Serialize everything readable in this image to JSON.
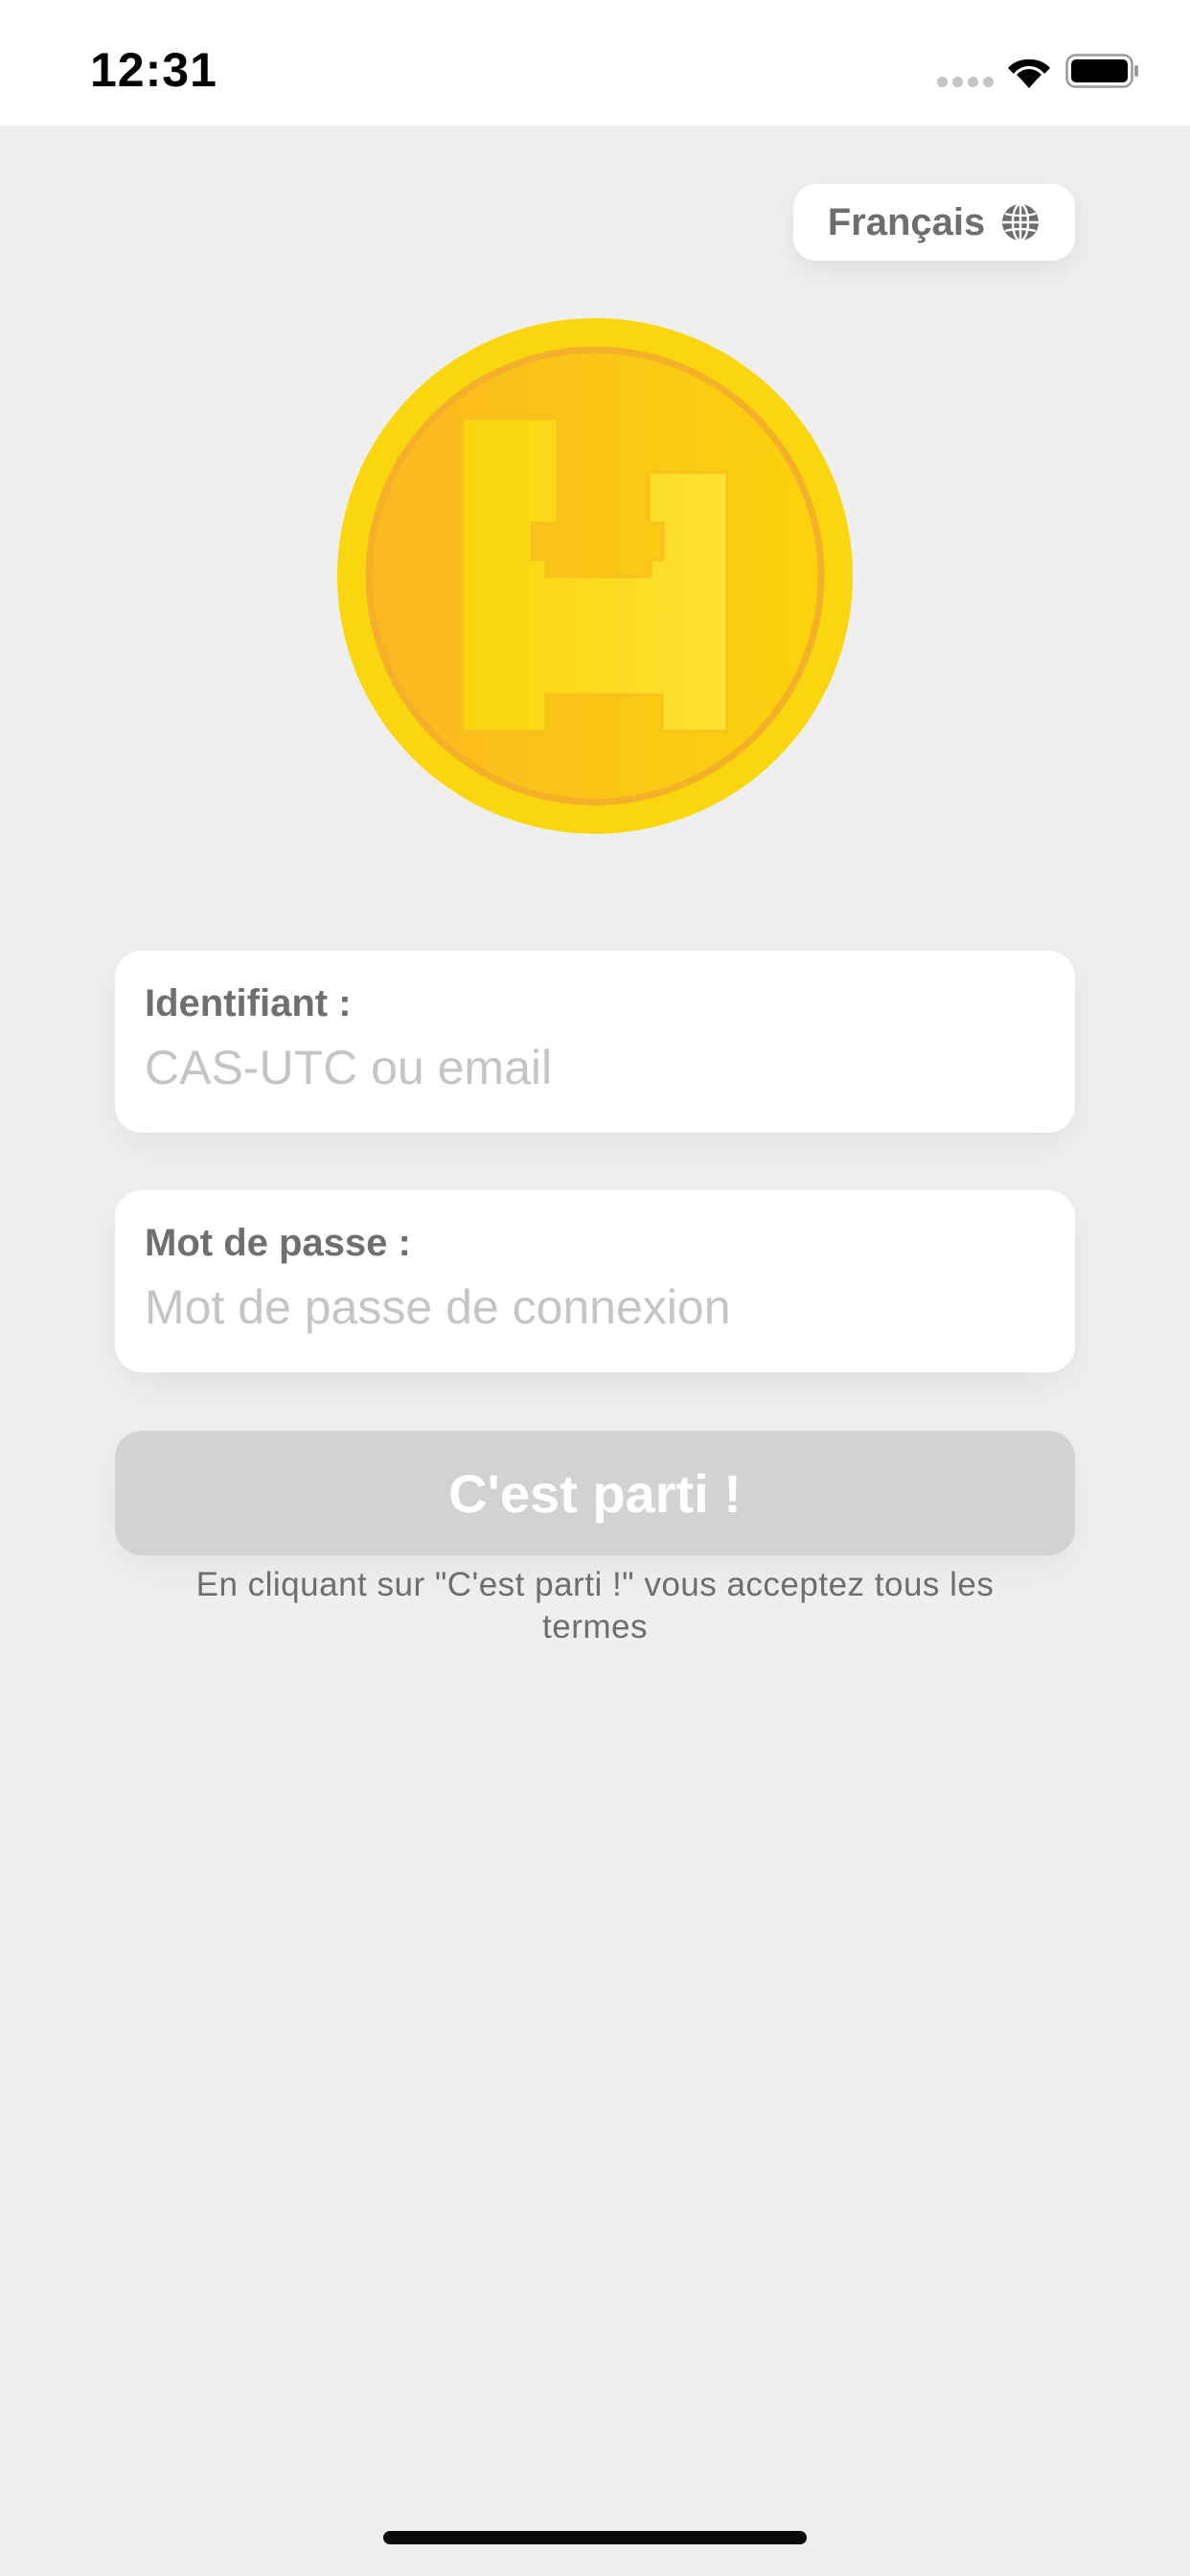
{
  "status_bar": {
    "time": "12:31"
  },
  "language": {
    "label": "Français",
    "icon": "globe-icon"
  },
  "logo": {
    "icon": "coin-logo",
    "colors": {
      "coin_outer": "#FAD60E",
      "coin_inner": "#FBC51A",
      "coin_rim": "#F7B72A"
    }
  },
  "form": {
    "login": {
      "label": "Identifiant :",
      "placeholder": "CAS-UTC ou email",
      "value": ""
    },
    "password": {
      "label": "Mot de passe :",
      "placeholder": "Mot de passe de connexion",
      "value": ""
    },
    "submit_label": "C'est parti !",
    "terms": "En cliquant sur \"C'est parti !\" vous acceptez tous les termes"
  },
  "colors": {
    "background": "#EFEFEF",
    "button_disabled": "#D2D2D2",
    "label_text": "#6F6F6F",
    "placeholder": "#C5C5C5"
  }
}
